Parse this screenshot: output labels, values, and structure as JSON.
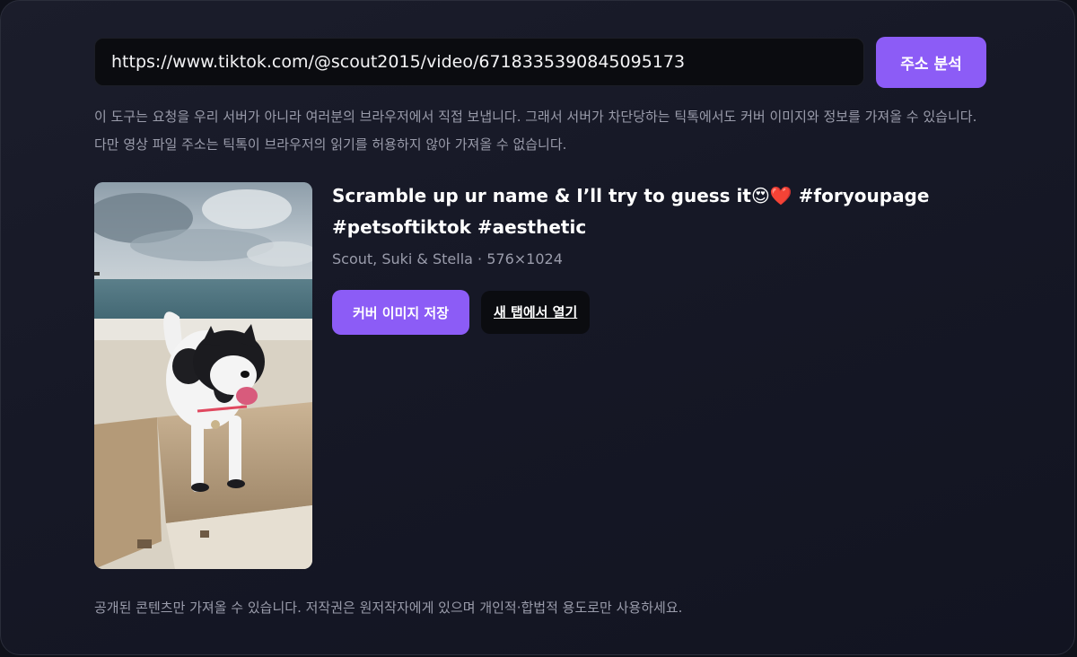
{
  "url_input": {
    "value": "https://www.tiktok.com/@scout2015/video/6718335390845095173"
  },
  "analyze_button": {
    "label": "주소 분석"
  },
  "info_note": "이 도구는 요청을 우리 서버가 아니라 여러분의 브라우저에서 직접 보냅니다. 그래서 서버가 차단당하는 틱톡에서도 커버 이미지와 정보를 가져올 수 있습니다. 다만 영상 파일 주소는 틱톡이 브라우저의 읽기를 허용하지 않아 가져올 수 없습니다.",
  "result": {
    "title": "Scramble up ur name & I’ll try to guess it😍❤️ #foryoupage #petsoftiktok #aesthetic",
    "meta": "Scout, Suki & Stella · 576×1024",
    "save_cover_label": "커버 이미지 저장",
    "open_new_tab_label": "새 탭에서 열기"
  },
  "footer_note": "공개된 콘텐츠만 가져올 수 있습니다. 저작권은 원저작자에게 있으며 개인적·합법적 용도로만 사용하세요.",
  "colors": {
    "accent": "#8c5cf6",
    "background": "#161826",
    "input_bg": "#0b0c10",
    "muted_text": "#9a9cab"
  }
}
